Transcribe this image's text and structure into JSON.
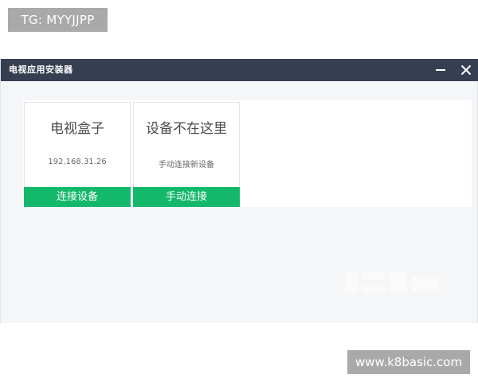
{
  "overlay": {
    "tg_label": "TG: MYYJJPP",
    "site_label": "www.k8basic.com"
  },
  "window": {
    "title": "电视应用安装器",
    "titlebar_color": "#363f52",
    "controls": {
      "minimize_icon": "minimize-icon",
      "close_icon": "close-icon"
    }
  },
  "cards": [
    {
      "title": "电视盒子",
      "subtitle": "192.168.31.26",
      "button_label": "连接设备"
    },
    {
      "title": "设备不在这里",
      "subtitle": "手动连接新设备",
      "button_label": "手动连接"
    }
  ],
  "colors": {
    "accent_green": "#14b86a",
    "window_bg": "#f5f6f8"
  }
}
